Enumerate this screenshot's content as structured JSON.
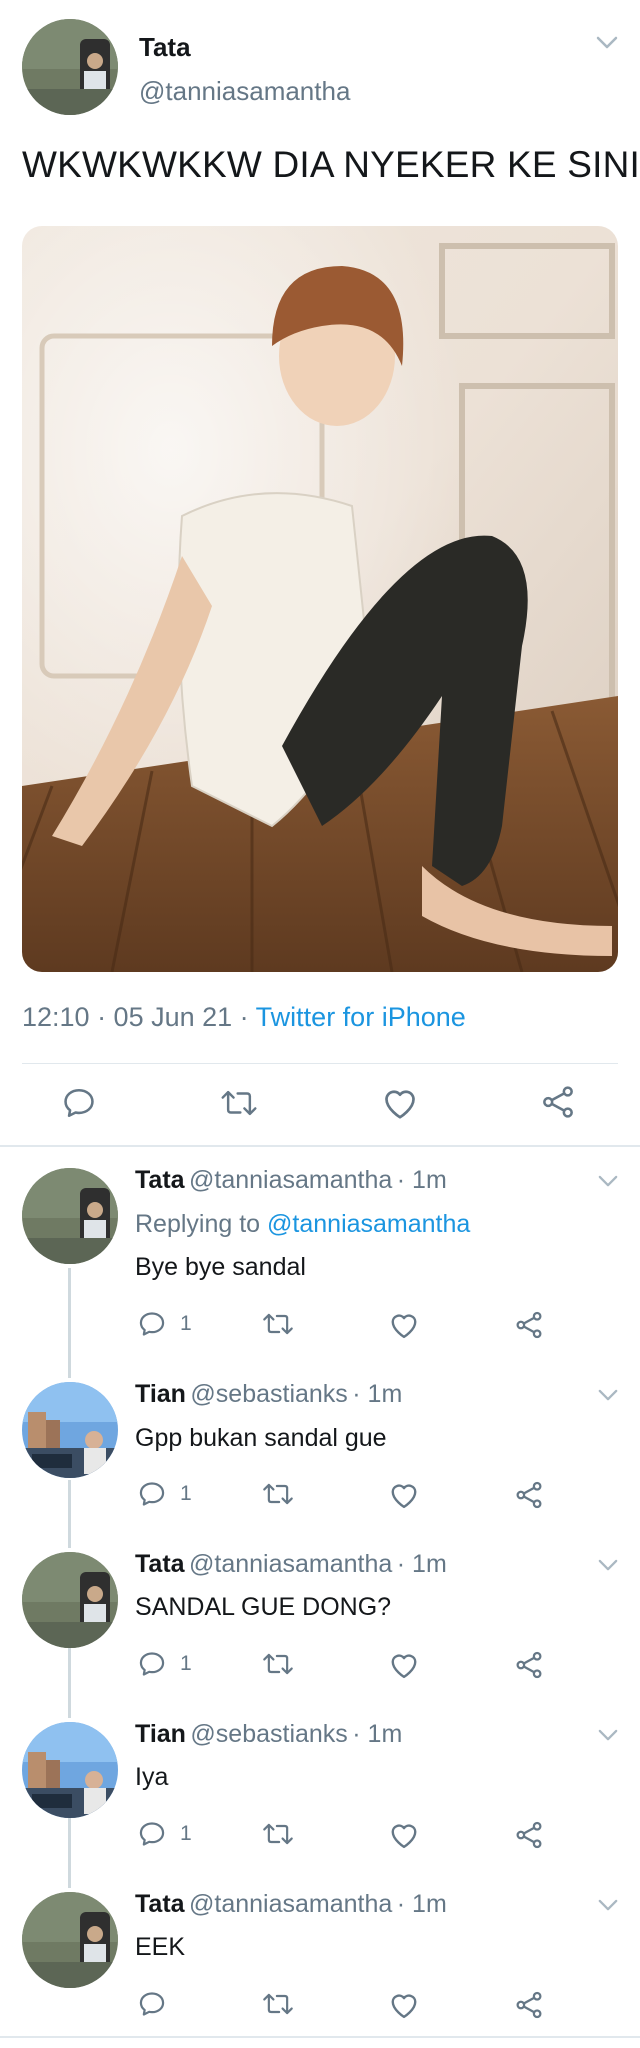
{
  "tweet": {
    "author_name": "Tata",
    "author_handle": "@tanniasamantha",
    "text": "WKWKWKKW DIA NYEKER KE SINI",
    "time": "12:10 · 05 Jun 21 ·",
    "source": "Twitter for iPhone",
    "icons": [
      "reply-icon",
      "retweet-icon",
      "like-icon",
      "share-icon"
    ]
  },
  "replies": [
    {
      "name": "Tata",
      "handle": "@tanniasamantha",
      "time": "· 1m",
      "replying_label": "Replying to",
      "replying_to": "@tanniasamantha",
      "text": "Bye bye sandal",
      "reply_count": "1"
    },
    {
      "name": "Tian",
      "handle": "@sebastianks",
      "time": "· 1m",
      "text": "Gpp bukan sandal gue",
      "reply_count": "1"
    },
    {
      "name": "Tata",
      "handle": "@tanniasamantha",
      "time": "· 1m",
      "text": "SANDAL GUE DONG?",
      "reply_count": "1"
    },
    {
      "name": "Tian",
      "handle": "@sebastianks",
      "time": "· 1m",
      "text": "Iya",
      "reply_count": "1"
    },
    {
      "name": "Tata",
      "handle": "@tanniasamantha",
      "time": "· 1m",
      "text": "EEK",
      "reply_count": ""
    }
  ],
  "colors": {
    "link": "#1b95e0",
    "muted": "#657786",
    "divider": "#e1e8ed"
  }
}
